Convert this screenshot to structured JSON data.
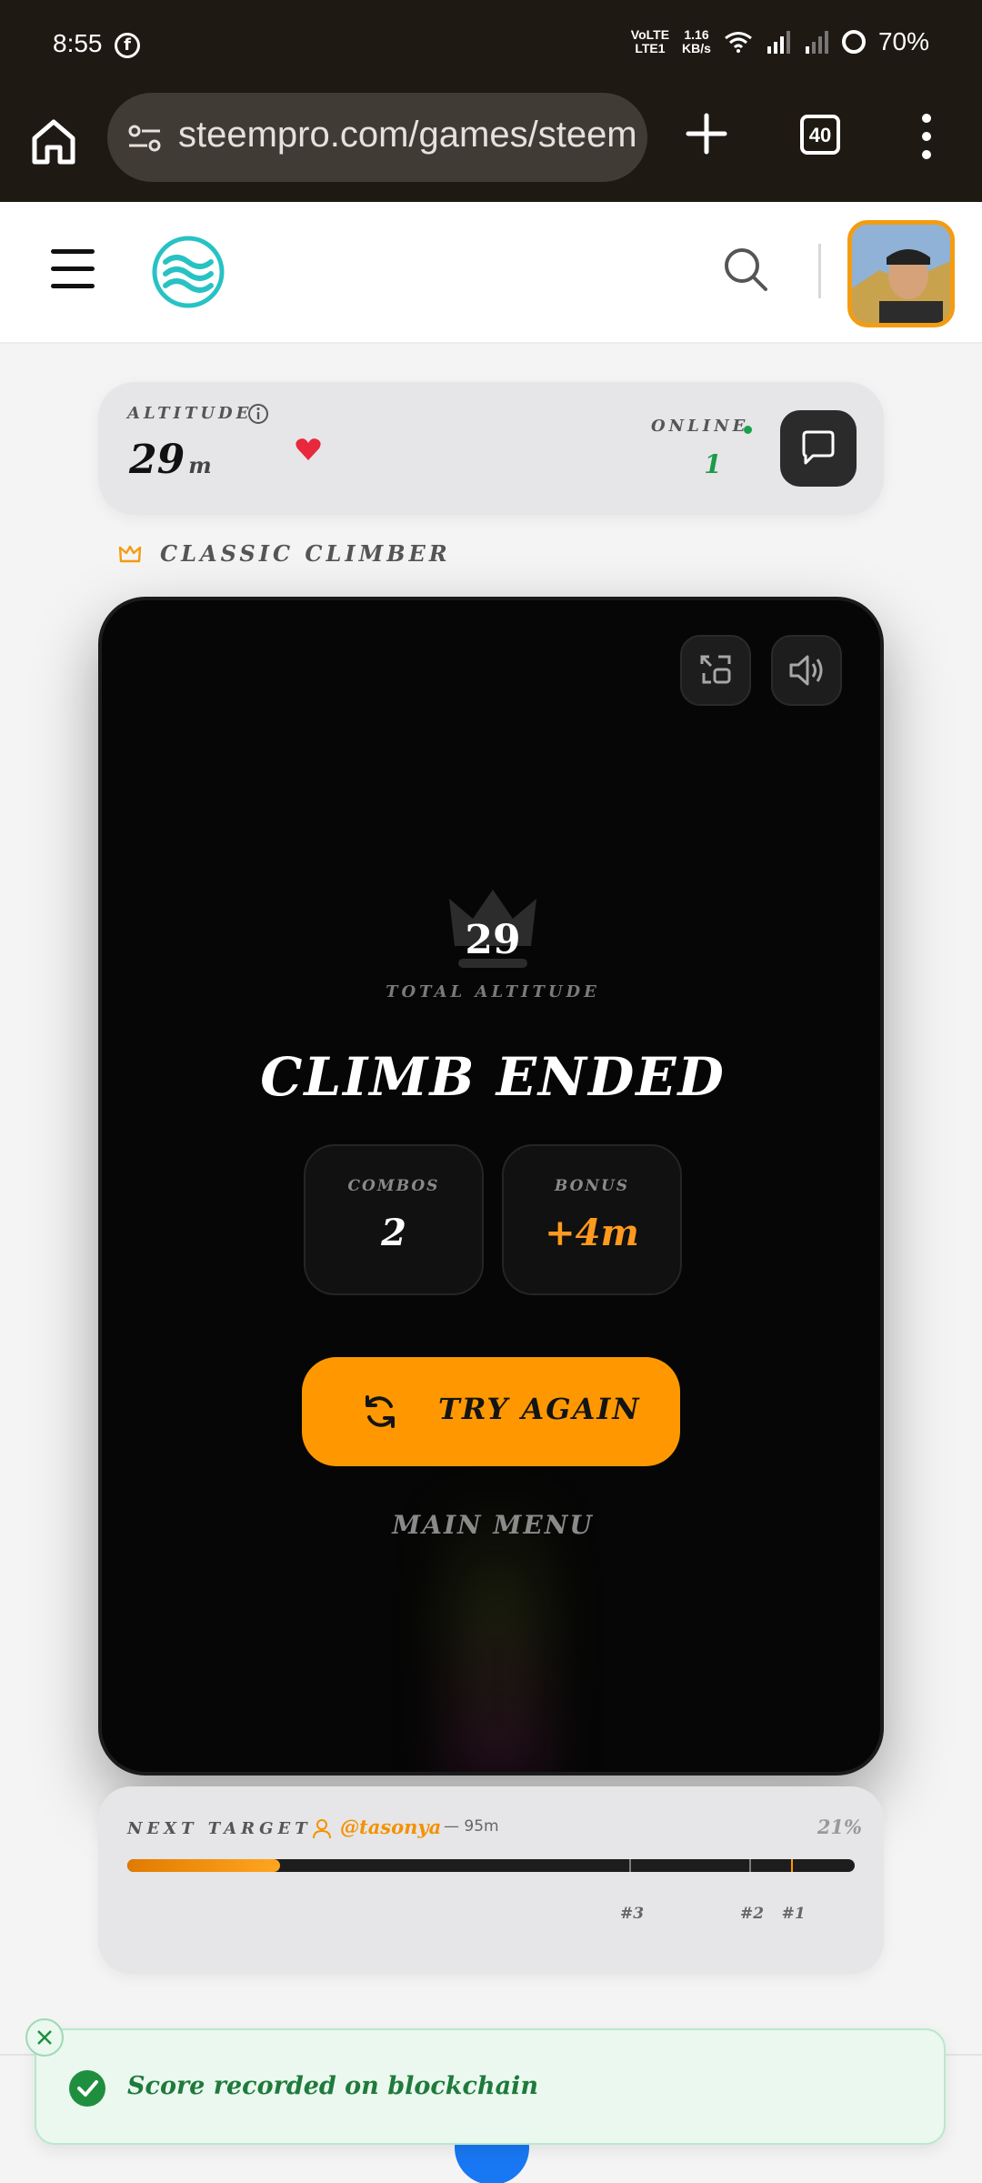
{
  "status_bar": {
    "time": "8:55",
    "net_type": "LTE1",
    "net_top": "VoLTE",
    "speed_value": "1.16",
    "speed_unit": "KB/s",
    "battery": "70%"
  },
  "browser": {
    "url": "steempro.com/games/steem",
    "tab_count": "40"
  },
  "header": {
    "logo": "steempro-wave-logo",
    "search_icon": "search-icon"
  },
  "altitude_panel": {
    "label": "ALTITUDE",
    "value": "29",
    "unit": "m",
    "online_label": "ONLINE",
    "online_count": "1"
  },
  "mode": {
    "label": "CLASSIC CLIMBER"
  },
  "game": {
    "total_score": "29",
    "total_label": "TOTAL ALTITUDE",
    "title": "CLIMB ENDED",
    "stats": [
      {
        "label": "COMBOS",
        "value": "2",
        "color": "#ffffff"
      },
      {
        "label": "BONUS",
        "value": "+4m",
        "color": "#ff9a1f"
      }
    ],
    "try_again_label": "TRY AGAIN",
    "main_menu_label": "MAIN MENU"
  },
  "next_target": {
    "label": "NEXT TARGET",
    "user": "@tasonya",
    "distance": "— 95m",
    "percent_text": "21%",
    "progress": 0.21,
    "ranks": [
      {
        "label": "#3",
        "position": 0.69
      },
      {
        "label": "#2",
        "position": 0.855
      },
      {
        "label": "#1",
        "position": 0.912
      }
    ]
  },
  "toast": {
    "message": "Score recorded on blockchain"
  },
  "colors": {
    "accent": "#ff9800",
    "success": "#1f8f3f",
    "dark_bg": "#060606"
  }
}
